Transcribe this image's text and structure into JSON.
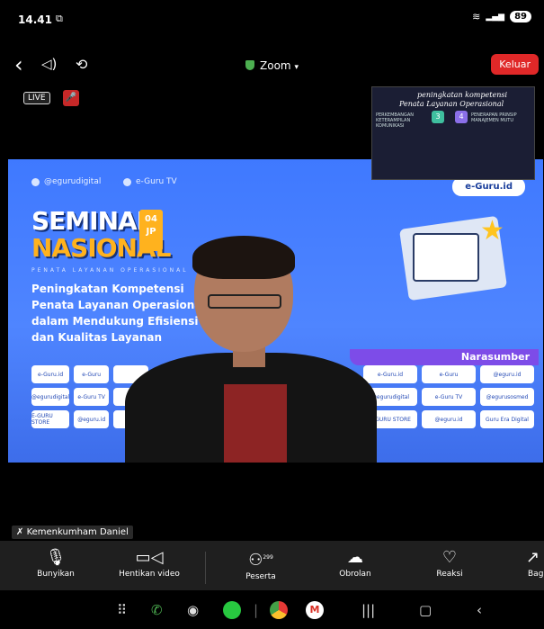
{
  "status_bar": {
    "time": "14.41",
    "battery": "89"
  },
  "top_bar": {
    "title": "Zoom",
    "leave_label": "Keluar"
  },
  "badges": {
    "live": "LIVE"
  },
  "slide": {
    "social_left": "@egurudigital",
    "social_right": "e-Guru TV",
    "site": "e-Guru.id",
    "heading_line1": "SEMINAR",
    "heading_line2": "NASIONAL",
    "jp_number": "04",
    "jp_label": "JP",
    "tagline": "PENATA LAYANAN OPERASIONAL",
    "description": "Peningkatan Kompetensi Penata Layanan Operasional dalam Mendukung Efisiensi dan Kualitas Layanan",
    "narasumber_label": "Narasumber",
    "logos_left": [
      "e-Guru.id",
      "e-Guru",
      "",
      "@egurudigital",
      "e-Guru TV",
      "",
      "E-GURU STORE",
      "@eguru.id",
      ""
    ],
    "logos_right": [
      "e-Guru.id",
      "e-Guru",
      "@eguru.id",
      "@egurudigital",
      "e-Guru TV",
      "@egurusosmed",
      "E-GURU STORE",
      "@eguru.id",
      "Guru Era Digital"
    ]
  },
  "shared_thumbnail": {
    "title_line1": "peningkatan kompetensi",
    "title_line2": "Penata Layanan Operasional",
    "col1_heading": "PERKEMBANGAN KETERAMPILAN KOMUNIKASI",
    "col2_heading": "PENERAPAN PRINSIP MANAJEMEN MUTU",
    "num1": "3",
    "num2": "4"
  },
  "participant_name": "Kemenkumham Daniel",
  "toolbar": {
    "items": [
      {
        "label": "Bunyikan",
        "icon": "microphone-muted-icon"
      },
      {
        "label": "Hentikan video",
        "icon": "video-camera-icon"
      },
      {
        "label": "Peserta",
        "icon": "participants-icon",
        "count": "299"
      },
      {
        "label": "Obrolan",
        "icon": "chat-icon"
      },
      {
        "label": "Reaksi",
        "icon": "heart-icon"
      },
      {
        "label": "Bag",
        "icon": "share-icon"
      }
    ]
  },
  "colors": {
    "leave": "#e02828",
    "slide_blue": "#4f85ff",
    "accent_orange": "#ffb21e",
    "narasumber_purple": "#7d4ce8"
  }
}
